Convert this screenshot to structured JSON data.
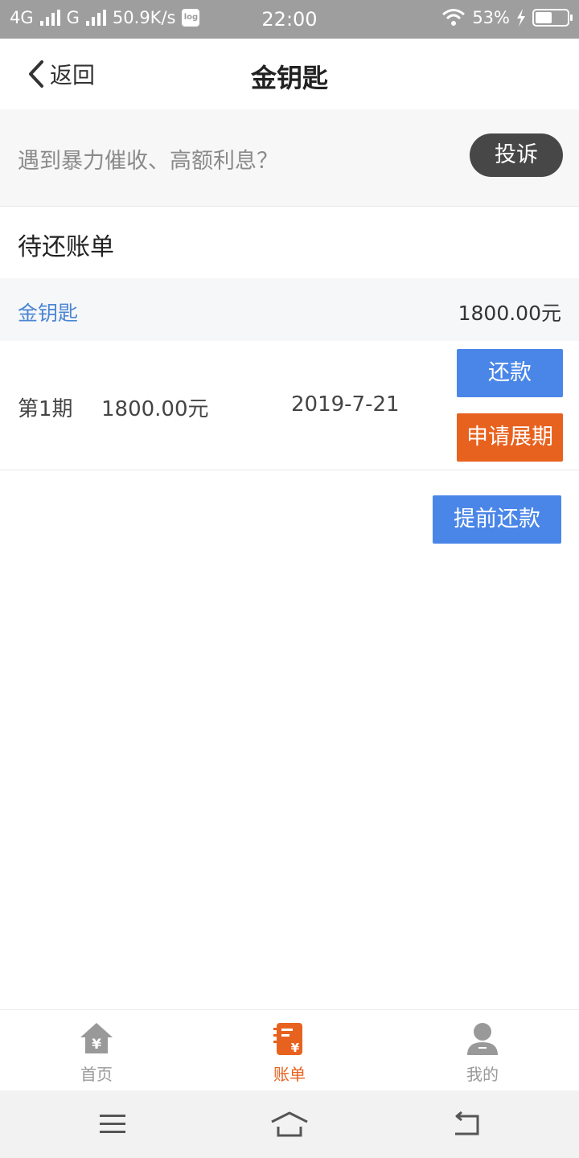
{
  "status_bar": {
    "network_1": "4G",
    "network_2": "G",
    "speed": "50.9K/s",
    "log_badge": "log",
    "time": "22:00",
    "battery_percent": "53%",
    "battery_level": 0.53,
    "icons": [
      "signal-icon",
      "wifi-icon",
      "charging-icon",
      "battery-icon"
    ]
  },
  "header": {
    "back_label": "返回",
    "title": "金钥匙"
  },
  "complaint": {
    "text": "遇到暴力催收、高额利息？",
    "button_label": "投诉"
  },
  "bills": {
    "section_title": "待还账单",
    "lender": {
      "name": "金钥匙",
      "amount": "1800.00元"
    },
    "installments": [
      {
        "period": "第1期",
        "amount": "1800.00元",
        "due_date": "2019-7-21",
        "repay_label": "还款",
        "extend_label": "申请展期"
      }
    ],
    "prepay_label": "提前还款"
  },
  "tabs": [
    {
      "label": "首页",
      "icon": "home-yen-icon",
      "active": false
    },
    {
      "label": "账单",
      "icon": "bill-icon",
      "active": true
    },
    {
      "label": "我的",
      "icon": "user-icon",
      "active": false
    }
  ],
  "colors": {
    "primary_blue": "#4a86e8",
    "accent_orange": "#e8621f",
    "link_blue": "#4a86d4",
    "complaint_button": "#474747",
    "inactive_tab": "#999999"
  },
  "system_nav": [
    "menu-icon",
    "home-icon",
    "back-icon"
  ]
}
